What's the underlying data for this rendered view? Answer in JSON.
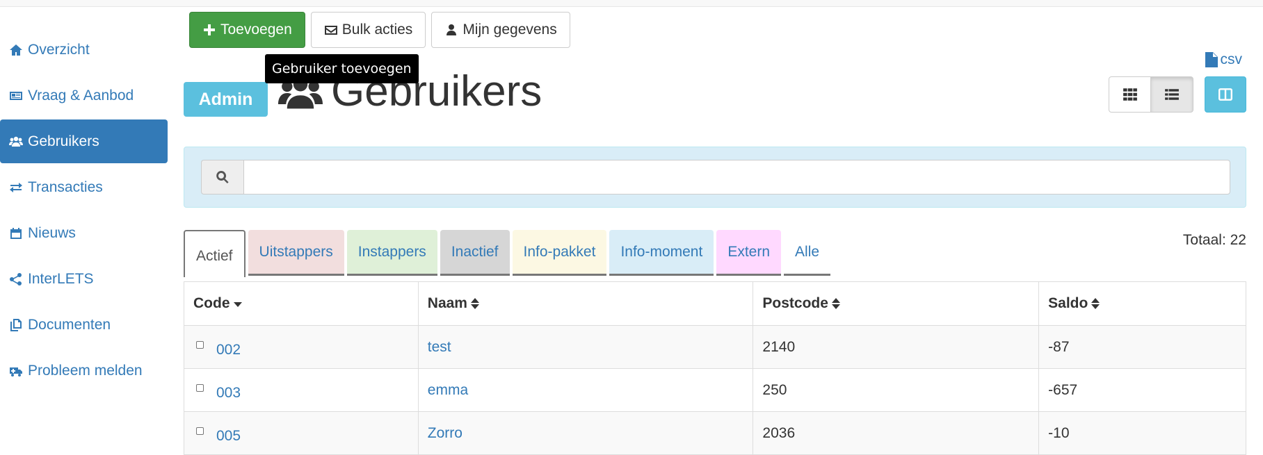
{
  "sidebar": {
    "items": [
      {
        "label": "Overzicht",
        "icon": "home-icon"
      },
      {
        "label": "Vraag & Aanbod",
        "icon": "newspaper-icon"
      },
      {
        "label": "Gebruikers",
        "icon": "users-icon",
        "active": true
      },
      {
        "label": "Transacties",
        "icon": "exchange-icon"
      },
      {
        "label": "Nieuws",
        "icon": "calendar-icon"
      },
      {
        "label": "InterLETS",
        "icon": "share-icon"
      },
      {
        "label": "Documenten",
        "icon": "files-icon"
      },
      {
        "label": "Probleem melden",
        "icon": "ambulance-icon"
      }
    ]
  },
  "toolbar": {
    "add_label": "Toevoegen",
    "bulk_label": "Bulk acties",
    "profile_label": "Mijn gegevens"
  },
  "tooltip": {
    "text": "Gebruiker toevoegen"
  },
  "export": {
    "csv_label": "csv"
  },
  "header": {
    "badge": "Admin",
    "title": "Gebruikers"
  },
  "search": {
    "placeholder": "",
    "value": ""
  },
  "tabs": [
    {
      "label": "Actief",
      "color": "#ffffff",
      "active": true
    },
    {
      "label": "Uitstappers",
      "color": "#f2dede"
    },
    {
      "label": "Instappers",
      "color": "#dff0d8"
    },
    {
      "label": "Inactief",
      "color": "#d6d6d6"
    },
    {
      "label": "Info-pakket",
      "color": "#fcf8e3"
    },
    {
      "label": "Info-moment",
      "color": "#d9edf7"
    },
    {
      "label": "Extern",
      "color": "#ffd9ff"
    },
    {
      "label": "Alle",
      "color": "#ffffff"
    }
  ],
  "total": {
    "text": "Totaal: 22"
  },
  "table": {
    "columns": [
      "Code",
      "Naam",
      "Postcode",
      "Saldo"
    ],
    "rows": [
      {
        "code": "002",
        "naam": "test",
        "postcode": "2140",
        "saldo": "-87"
      },
      {
        "code": "003",
        "naam": "emma",
        "postcode": "250",
        "saldo": "-657"
      },
      {
        "code": "005",
        "naam": "Zorro",
        "postcode": "2036",
        "saldo": "-10"
      }
    ]
  },
  "colors": {
    "primary": "#337ab7",
    "success": "#449d44",
    "info": "#5bc0de",
    "panel": "#d9edf7"
  }
}
